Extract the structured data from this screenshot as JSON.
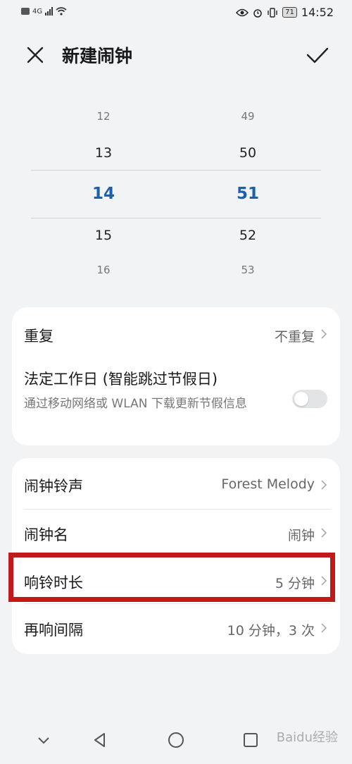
{
  "status": {
    "network": "4G",
    "battery": "71",
    "time": "14:52"
  },
  "header": {
    "title": "新建闹钟"
  },
  "picker": {
    "hours": [
      "12",
      "13",
      "14",
      "15",
      "16"
    ],
    "minutes": [
      "49",
      "50",
      "51",
      "52",
      "53"
    ],
    "selected_hour": "14",
    "selected_minute": "51",
    "accent_color": "#1d5fa8"
  },
  "repeat": {
    "label": "重复",
    "value": "不重复"
  },
  "workday": {
    "title": "法定工作日 (智能跳过节假日)",
    "description": "通过移动网络或 WLAN 下载更新节假信息",
    "enabled": false
  },
  "settings": [
    {
      "label": "闹钟铃声",
      "value": "Forest Melody"
    },
    {
      "label": "闹钟名",
      "value": "闹钟"
    },
    {
      "label": "响铃时长",
      "value": "5 分钟"
    },
    {
      "label": "再响间隔",
      "value": "10 分钟，3 次"
    }
  ],
  "highlight_color": "#c11a1a",
  "watermark": "Baidu经验"
}
